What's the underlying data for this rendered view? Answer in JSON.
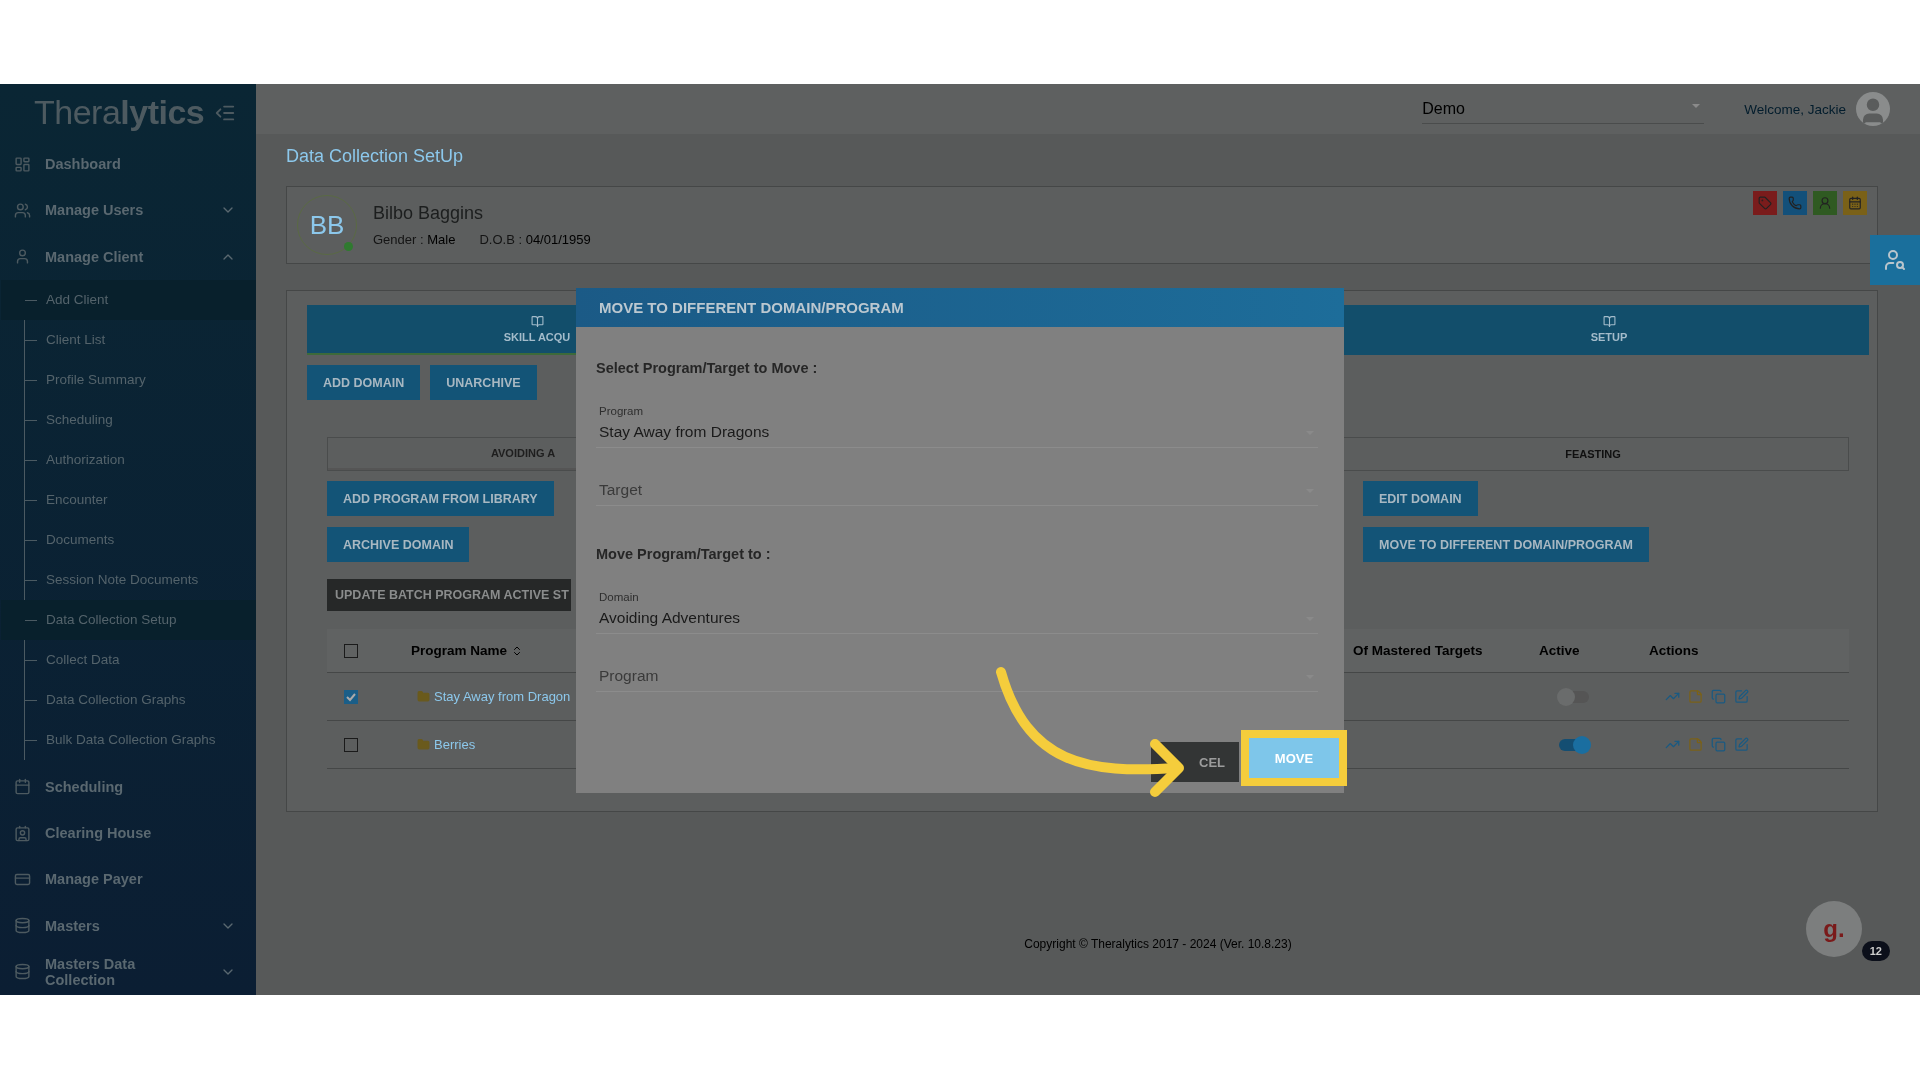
{
  "app": {
    "logo": "Thera**lytics**"
  },
  "sidebar": {
    "items": [
      {
        "kind": "link",
        "label": "Dashboard"
      },
      {
        "kind": "group",
        "label": "Manage Users",
        "expanded": false
      },
      {
        "kind": "group",
        "label": "Manage Client",
        "expanded": true,
        "children": [
          {
            "label": "Add Client",
            "selected": true
          },
          {
            "label": "Client List",
            "selected": false
          },
          {
            "label": "Profile Summary",
            "selected": false
          },
          {
            "label": "Scheduling",
            "selected": false
          },
          {
            "label": "Authorization",
            "selected": false
          },
          {
            "label": "Encounter",
            "selected": false
          },
          {
            "label": "Documents",
            "selected": false
          },
          {
            "label": "Session Note Documents",
            "selected": false
          },
          {
            "label": "Data Collection Setup",
            "selected": true
          },
          {
            "label": "Collect Data",
            "selected": false
          },
          {
            "label": "Data Collection Graphs",
            "selected": false
          },
          {
            "label": "Bulk Data Collection Graphs",
            "selected": false
          }
        ]
      },
      {
        "kind": "link",
        "label": "Scheduling"
      },
      {
        "kind": "link",
        "label": "Clearing House"
      },
      {
        "kind": "link",
        "label": "Manage Payer"
      },
      {
        "kind": "group",
        "label": "Masters",
        "expanded": false
      },
      {
        "kind": "group",
        "label": "Masters Data Collection",
        "expanded": false
      }
    ]
  },
  "top_bar": {
    "site_select": "Demo",
    "welcome": "Welcome, Jackie"
  },
  "page_title": "Data Collection SetUp",
  "client": {
    "initials": "BB",
    "online": true,
    "name": "Bilbo Baggins",
    "gender_label": "Gender :",
    "gender": "Male",
    "dob_label": "D.O.B :",
    "dob": "04/01/1959"
  },
  "main_tabs": [
    {
      "label": "SKILL ACQU",
      "selected": true
    },
    {
      "label": "SETUP",
      "selected": false
    }
  ],
  "buttons": [
    "ADD DOMAIN",
    "UNARCHIVE"
  ],
  "domain_tabs": [
    {
      "label": "AVOIDING A",
      "selected": true
    },
    {
      "label": "FEASTING",
      "selected": false
    }
  ],
  "domain_buttons": [
    "ADD PROGRAM FROM LIBRARY",
    "EDIT DOMAIN",
    "ARCHIVE DOMAIN",
    "MOVE TO DIFFERENT DOMAIN/PROGRAM"
  ],
  "batch_button": "UPDATE BATCH PROGRAM ACTIVE ST",
  "table": {
    "select_all": false,
    "columns": [
      "Program Name",
      "Of Mastered Targets",
      "Active",
      "Actions"
    ],
    "rows": [
      {
        "checked": true,
        "name": "Stay Away from Dragon",
        "active": false
      },
      {
        "checked": false,
        "name": "Berries",
        "active": true
      }
    ]
  },
  "dialog": {
    "title": "MOVE TO DIFFERENT DOMAIN/PROGRAM",
    "sections": [
      {
        "heading": "Select Program/Target to Move :",
        "fields": [
          {
            "label": "Program",
            "value": "Stay Away from Dragons"
          },
          {
            "placeholder": "Target"
          }
        ]
      },
      {
        "heading": "Move Program/Target to :",
        "fields": [
          {
            "label": "Domain",
            "value": "Avoiding Adventures"
          },
          {
            "placeholder": "Program"
          }
        ]
      }
    ],
    "cancel": "CEL",
    "confirm": "MOVE"
  },
  "footer": "Copyright © Theralytics 2017 - 2024 (Ver. 10.8.23)",
  "chat": {
    "logo": "g.",
    "badge": "12"
  }
}
